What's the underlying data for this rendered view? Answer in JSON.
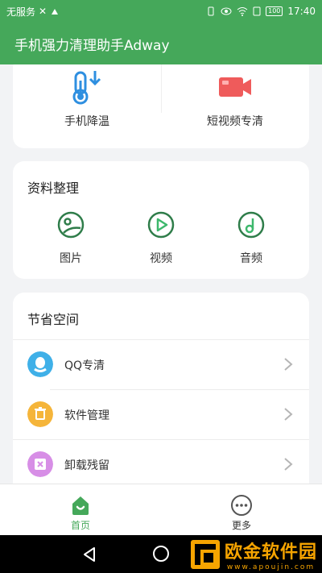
{
  "status": {
    "carrier": "无服务",
    "time": "17:40",
    "battery": "100"
  },
  "appbar": {
    "title": "手机强力清理助手Adway"
  },
  "tools": [
    {
      "label": "手机降温",
      "icon": "thermometer-cool-icon"
    },
    {
      "label": "短视频专清",
      "icon": "video-camera-icon"
    }
  ],
  "organize": {
    "title": "资料整理",
    "items": [
      {
        "label": "图片",
        "icon": "image-icon"
      },
      {
        "label": "视频",
        "icon": "play-icon"
      },
      {
        "label": "音频",
        "icon": "music-icon"
      }
    ]
  },
  "save_space": {
    "title": "节省空间",
    "items": [
      {
        "label": "QQ专清",
        "icon": "qq-icon",
        "color": "#3fb0e8"
      },
      {
        "label": "软件管理",
        "icon": "trash-icon",
        "color": "#f5b53a"
      },
      {
        "label": "卸载残留",
        "icon": "uninstall-box-icon",
        "color": "#d78ee6"
      }
    ]
  },
  "bottom_nav": [
    {
      "label": "首页",
      "icon": "home-icon",
      "active": true
    },
    {
      "label": "更多",
      "icon": "more-icon",
      "active": false
    }
  ],
  "colors": {
    "primary": "#45a85a",
    "nav_active": "#45a85a",
    "nav_inactive": "#333333"
  },
  "watermark": {
    "title": "欧金软件园",
    "url": "www.apoujin.com"
  }
}
